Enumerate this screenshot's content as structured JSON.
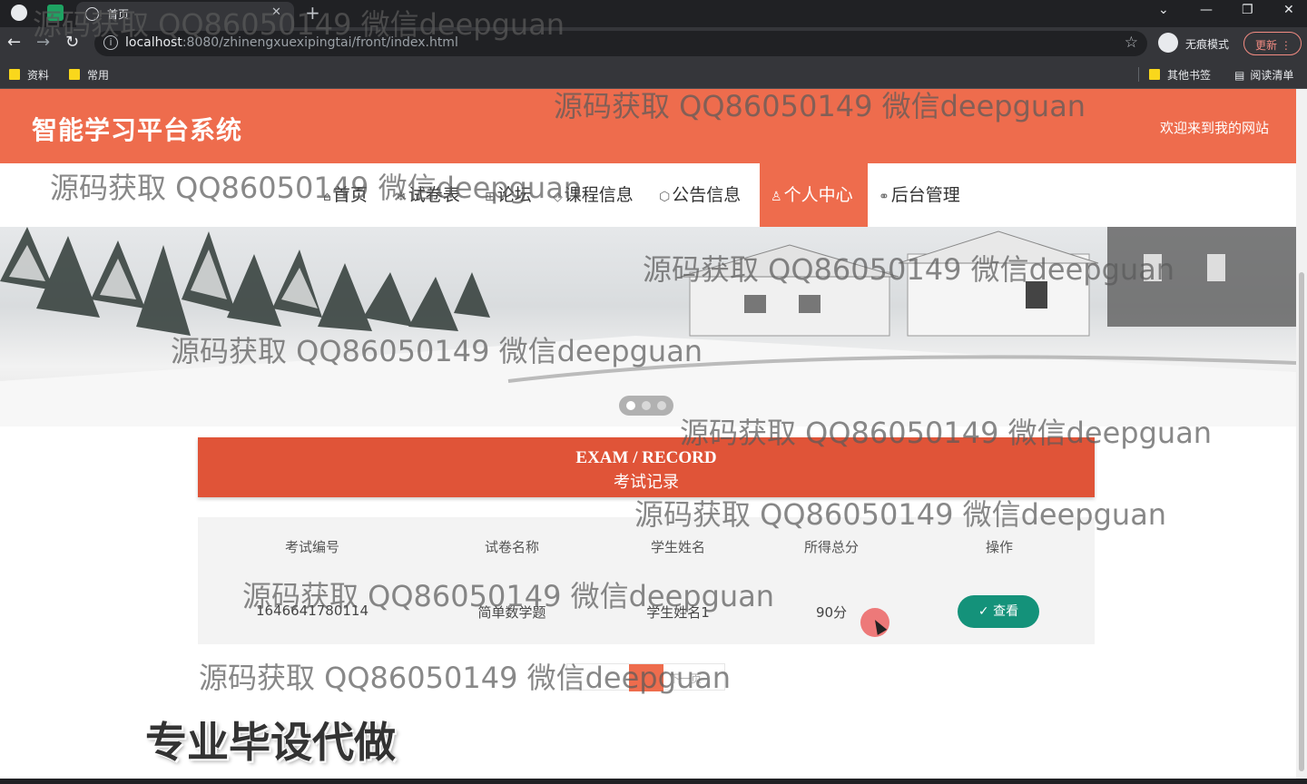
{
  "browser": {
    "tab_title": "首页",
    "url_host": "localhost",
    "url_path": ":8080/zhinengxuexipingtai/front/index.html",
    "incognito_label": "无痕模式",
    "update_label": "更新",
    "bookmarks": [
      "资料",
      "常用"
    ],
    "other_bookmarks": "其他书签",
    "reading_list": "阅读清单"
  },
  "site": {
    "title": "智能学习平台系统",
    "welcome": "欢迎来到我的网站"
  },
  "nav": [
    {
      "label": "首页",
      "icon": "home-icon"
    },
    {
      "label": "试卷表",
      "icon": "snowflake-icon"
    },
    {
      "label": "论坛",
      "icon": "grid-icon"
    },
    {
      "label": "课程信息",
      "icon": "tag-icon"
    },
    {
      "label": "公告信息",
      "icon": "cube-icon"
    },
    {
      "label": "个人中心",
      "icon": "user-icon",
      "active": true
    },
    {
      "label": "后台管理",
      "icon": "link-icon"
    }
  ],
  "section": {
    "title_en": "EXAM / RECORD",
    "title_cn": "考试记录"
  },
  "table": {
    "headers": [
      "考试编号",
      "试卷名称",
      "学生姓名",
      "所得总分",
      "操作"
    ],
    "rows": [
      {
        "id": "1646641780114",
        "paper": "简单数学题",
        "student": "学生姓名1",
        "score": "90分",
        "action": "查看"
      }
    ]
  },
  "pager": {
    "next": "下一页"
  },
  "watermark": "源码获取 QQ86050149 微信deepguan",
  "promo": "专业毕设代做",
  "colors": {
    "brand": "#ee6c4d",
    "section": "#e05438",
    "button": "#14927a"
  }
}
